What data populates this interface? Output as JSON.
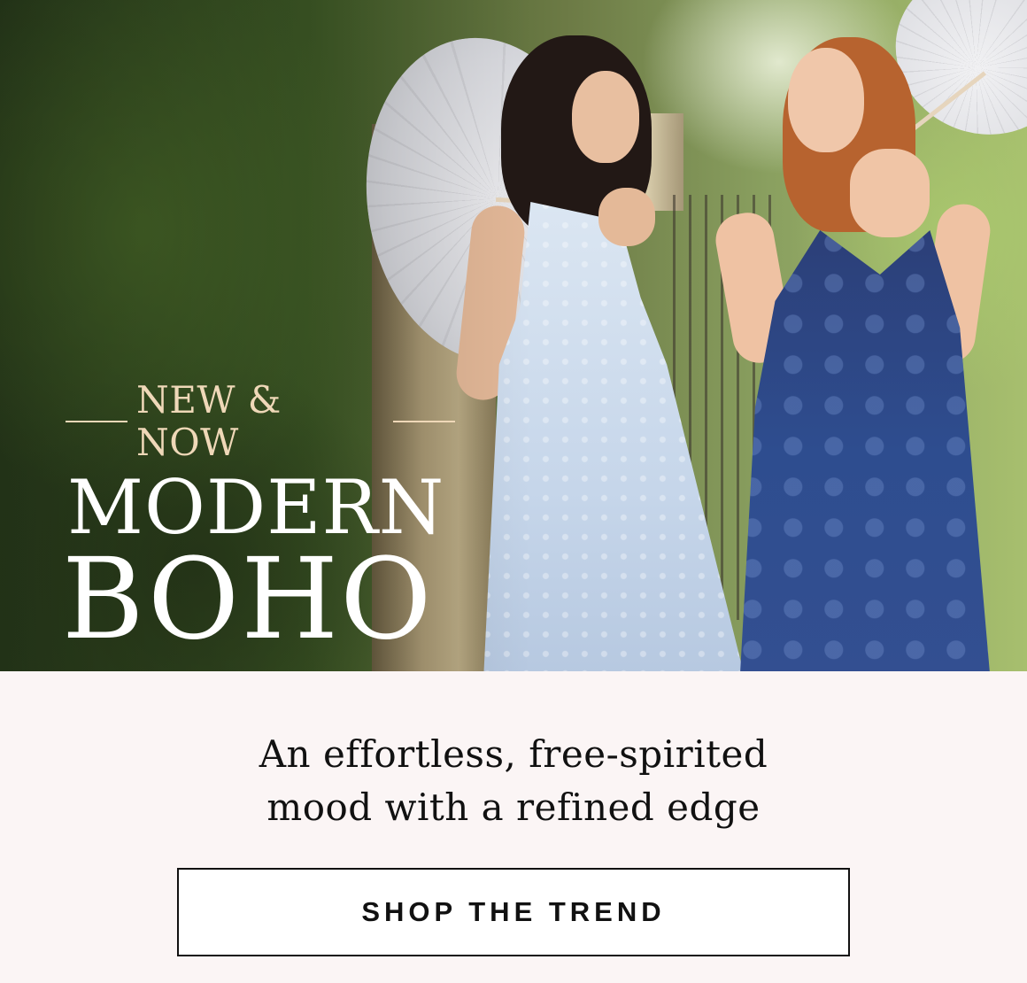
{
  "hero": {
    "kicker": "NEW & NOW",
    "title_line1": "MODERN",
    "title_line2": "BOHO"
  },
  "body": {
    "tagline_line1": "An effortless, free-spirited",
    "tagline_line2": "mood with a refined edge"
  },
  "cta": {
    "label": "SHOP THE TREND"
  },
  "colors": {
    "kicker": "#efd8b8",
    "title": "#ffffff",
    "background": "#fbf5f5",
    "button_border": "#111111"
  }
}
